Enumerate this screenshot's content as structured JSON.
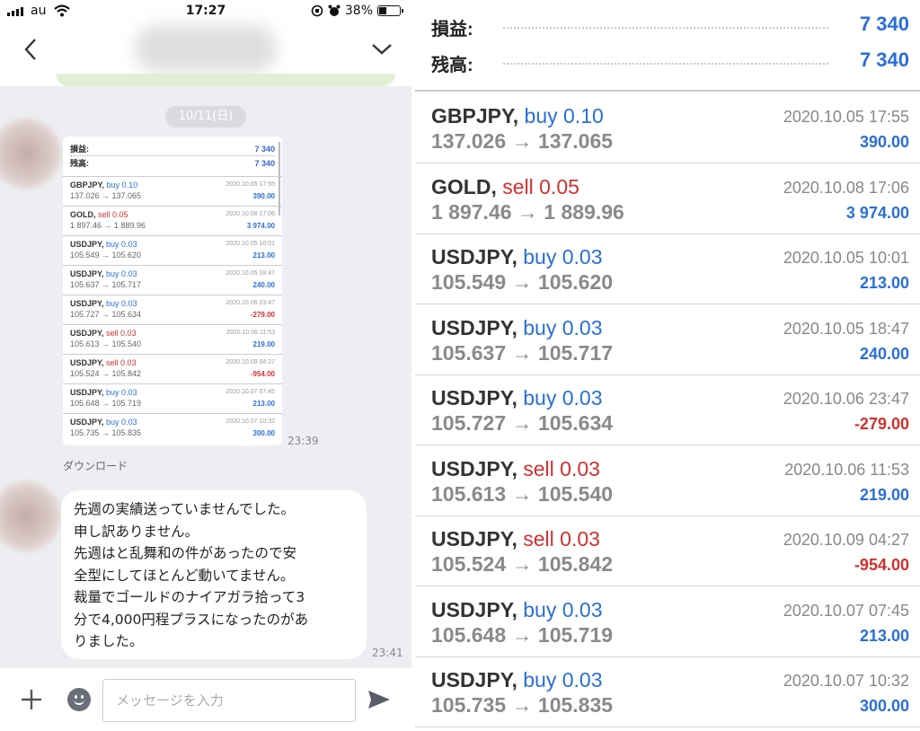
{
  "status_bar": {
    "carrier": "au",
    "time": "17:27",
    "battery": "38%"
  },
  "chat": {
    "date_label": "10/11(日)",
    "screenshot_time": "23:39",
    "download_label": "ダウンロード",
    "text_lines": [
      "先週の実績送っていませんでした。",
      "申し訳ありません。",
      "先週はと乱舞和の件があったので安",
      "全型にしてほとんど動いてません。",
      "裁量でゴールドのナイアガラ拾って3",
      "分で4,000円程プラスになったのがあ",
      "りました。"
    ],
    "text_time": "23:41",
    "input_placeholder": "メッセージを入力",
    "icons": {
      "back": "chevron-left-icon",
      "menu": "chevron-down-icon",
      "plus": "plus-icon",
      "emoji": "smiley-icon",
      "send": "send-icon"
    }
  },
  "summary": {
    "profit_label": "損益:",
    "profit_value": "7 340",
    "balance_label": "残高:",
    "balance_value": "7 340"
  },
  "trades": [
    {
      "symbol": "GBPJPY,",
      "side": "buy 0.10",
      "type": "buy",
      "prices": "137.026 → 137.065",
      "datetime": "2020.10.05 17:55",
      "profit": "390.00",
      "negative": false
    },
    {
      "symbol": "GOLD,",
      "side": "sell 0.05",
      "type": "sell",
      "prices": "1 897.46 → 1 889.96",
      "datetime": "2020.10.08 17:06",
      "profit": "3 974.00",
      "negative": false
    },
    {
      "symbol": "USDJPY,",
      "side": "buy 0.03",
      "type": "buy",
      "prices": "105.549 → 105.620",
      "datetime": "2020.10.05 10:01",
      "profit": "213.00",
      "negative": false
    },
    {
      "symbol": "USDJPY,",
      "side": "buy 0.03",
      "type": "buy",
      "prices": "105.637 → 105.717",
      "datetime": "2020.10.05 18:47",
      "profit": "240.00",
      "negative": false
    },
    {
      "symbol": "USDJPY,",
      "side": "buy 0.03",
      "type": "buy",
      "prices": "105.727 → 105.634",
      "datetime": "2020.10.06 23:47",
      "profit": "-279.00",
      "negative": true
    },
    {
      "symbol": "USDJPY,",
      "side": "sell 0.03",
      "type": "sell",
      "prices": "105.613 → 105.540",
      "datetime": "2020.10.06 11:53",
      "profit": "219.00",
      "negative": false
    },
    {
      "symbol": "USDJPY,",
      "side": "sell 0.03",
      "type": "sell",
      "prices": "105.524 → 105.842",
      "datetime": "2020.10.09 04:27",
      "profit": "-954.00",
      "negative": true
    },
    {
      "symbol": "USDJPY,",
      "side": "buy 0.03",
      "type": "buy",
      "prices": "105.648 → 105.719",
      "datetime": "2020.10.07 07:45",
      "profit": "213.00",
      "negative": false
    },
    {
      "symbol": "USDJPY,",
      "side": "buy 0.03",
      "type": "buy",
      "prices": "105.735 → 105.835",
      "datetime": "2020.10.07 10:32",
      "profit": "300.00",
      "negative": false
    }
  ],
  "colors": {
    "buy": "#2a6ed8",
    "sell": "#d32f2f",
    "profit_positive": "#2a6ed8",
    "profit_negative": "#d32f2f"
  }
}
